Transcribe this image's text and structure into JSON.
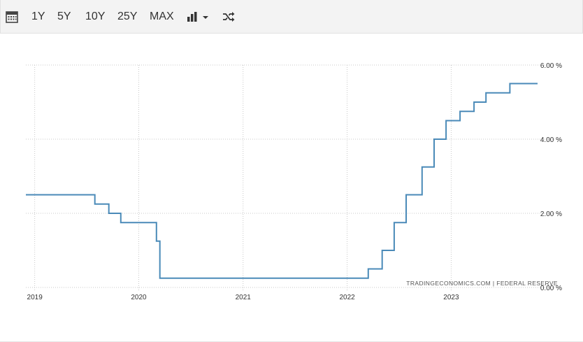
{
  "toolbar": {
    "calendar_icon": "calendar-icon",
    "ranges": [
      "1Y",
      "5Y",
      "10Y",
      "25Y",
      "MAX"
    ],
    "chart_type_icon": "bar-chart-icon",
    "dropdown_icon": "caret-down-icon",
    "compare_icon": "shuffle-icon"
  },
  "chart_data": {
    "type": "line",
    "step": true,
    "xlabel": "",
    "ylabel": "",
    "x_ticks": [
      "2019",
      "2020",
      "2021",
      "2022",
      "2023"
    ],
    "y_ticks": [
      "6.00 %",
      "4.00 %",
      "2.00 %",
      "0.00 %"
    ],
    "ylim": [
      0,
      6
    ],
    "xlim": [
      "2018-12-01",
      "2023-10-31"
    ],
    "grid": true,
    "line_color": "#4a8ab8",
    "source": "TRADINGECONOMICS.COM  |  FEDERAL RESERVE",
    "series": [
      {
        "points": [
          [
            "2018-12-01",
            2.5
          ],
          [
            "2019-07-31",
            2.25
          ],
          [
            "2019-09-18",
            2.0
          ],
          [
            "2019-10-30",
            1.75
          ],
          [
            "2020-03-03",
            1.25
          ],
          [
            "2020-03-15",
            0.25
          ],
          [
            "2022-03-16",
            0.5
          ],
          [
            "2022-05-04",
            1.0
          ],
          [
            "2022-06-15",
            1.75
          ],
          [
            "2022-07-27",
            2.5
          ],
          [
            "2022-09-21",
            3.25
          ],
          [
            "2022-11-02",
            4.0
          ],
          [
            "2022-12-14",
            4.5
          ],
          [
            "2023-02-01",
            4.75
          ],
          [
            "2023-03-22",
            5.0
          ],
          [
            "2023-05-03",
            5.25
          ],
          [
            "2023-07-26",
            5.5
          ],
          [
            "2023-10-31",
            5.5
          ]
        ]
      }
    ]
  }
}
